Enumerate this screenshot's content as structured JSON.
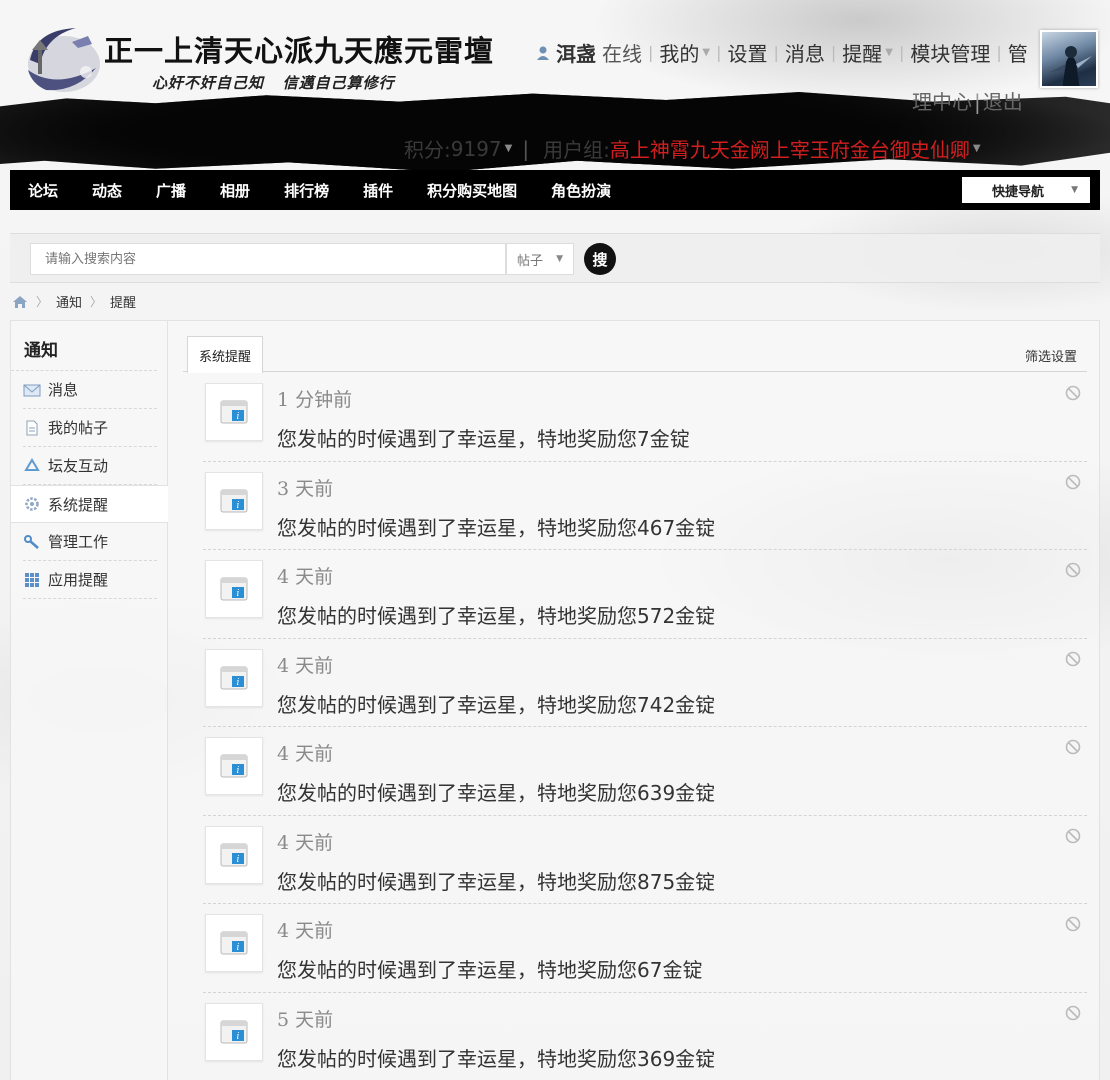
{
  "site": {
    "title": "正一上清天心派九天應元雷壇",
    "slogan": "心奸不奸自己知   信邁自己算修行"
  },
  "user_nav": {
    "username": "洱盏",
    "status": "在线",
    "mine": "我的",
    "settings": "设置",
    "messages": "消息",
    "alerts": "提醒",
    "module_manage": "模块管理",
    "admin_prefix": "管",
    "admin_suffix": "理中心",
    "logout": "退出"
  },
  "credit": {
    "label": "积分: ",
    "value": "9197",
    "group_label": "用户组: ",
    "group_value": "高上神霄九天金阙上宰玉府金台御史仙卿"
  },
  "main_nav": {
    "items": [
      "论坛",
      "动态",
      "广播",
      "相册",
      "排行榜",
      "插件",
      "积分购买地图",
      "角色扮演"
    ],
    "quick_nav": "快捷导航"
  },
  "search": {
    "placeholder": "请输入搜索内容",
    "type": "帖子",
    "button": "搜"
  },
  "breadcrumb": [
    "通知",
    "提醒"
  ],
  "sidebar": {
    "title": "通知",
    "items": [
      {
        "label": "消息",
        "icon": "envelope-icon"
      },
      {
        "label": "我的帖子",
        "icon": "document-icon"
      },
      {
        "label": "坛友互动",
        "icon": "recycle-icon"
      },
      {
        "label": "系统提醒",
        "icon": "gear-icon"
      },
      {
        "label": "管理工作",
        "icon": "wrench-icon"
      },
      {
        "label": "应用提醒",
        "icon": "grid-icon"
      }
    ]
  },
  "tabs": {
    "active": "系统提醒",
    "filter": "筛选设置"
  },
  "notices": [
    {
      "time": "1 分钟前",
      "text": "您发帖的时候遇到了幸运星，特地奖励您7金锭"
    },
    {
      "time": "3 天前",
      "text": "您发帖的时候遇到了幸运星，特地奖励您467金锭"
    },
    {
      "time": "4 天前",
      "text": "您发帖的时候遇到了幸运星，特地奖励您572金锭"
    },
    {
      "time": "4 天前",
      "text": "您发帖的时候遇到了幸运星，特地奖励您742金锭"
    },
    {
      "time": "4 天前",
      "text": "您发帖的时候遇到了幸运星，特地奖励您639金锭"
    },
    {
      "time": "4 天前",
      "text": "您发帖的时候遇到了幸运星，特地奖励您875金锭"
    },
    {
      "time": "4 天前",
      "text": "您发帖的时候遇到了幸运星，特地奖励您67金锭"
    },
    {
      "time": "5 天前",
      "text": "您发帖的时候遇到了幸运星，特地奖励您369金锭"
    }
  ],
  "colors": {
    "nav_bg": "#000000",
    "group_red": "#d21e1e",
    "accent_blue": "#2b8fd6"
  }
}
